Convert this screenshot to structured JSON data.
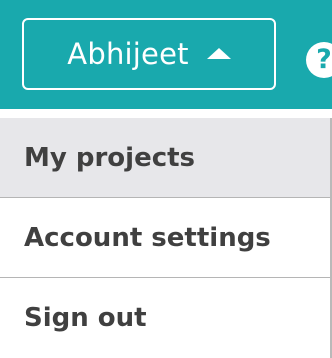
{
  "header": {
    "user_name": "Abhijeet",
    "help_symbol": "?",
    "caret_icon": "caret-up-icon",
    "colors": {
      "accent": "#19a9ad",
      "text_on_accent": "#ffffff"
    }
  },
  "user_menu": {
    "items": [
      {
        "label": "My projects",
        "active": true
      },
      {
        "label": "Account settings",
        "active": false
      },
      {
        "label": "Sign out",
        "active": false
      }
    ],
    "colors": {
      "active_background": "#e7e7ea",
      "text": "#404040",
      "divider": "#b5b5b5"
    }
  }
}
